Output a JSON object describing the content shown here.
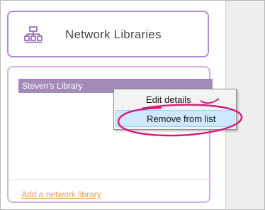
{
  "network_button": {
    "label": "Network Libraries",
    "icon": "network-tree-icon"
  },
  "library_list": {
    "items": [
      {
        "label": "Steven's Library"
      }
    ]
  },
  "context_menu": {
    "items": [
      {
        "label": "Edit details"
      },
      {
        "label": "Remove from list"
      }
    ]
  },
  "add_link": {
    "label": "Add a network library"
  },
  "colors": {
    "accent_purple": "#b48ccf",
    "selected_item": "#a28bb9",
    "link_orange": "#f0a036",
    "highlight_annotation": "#d6197a"
  }
}
